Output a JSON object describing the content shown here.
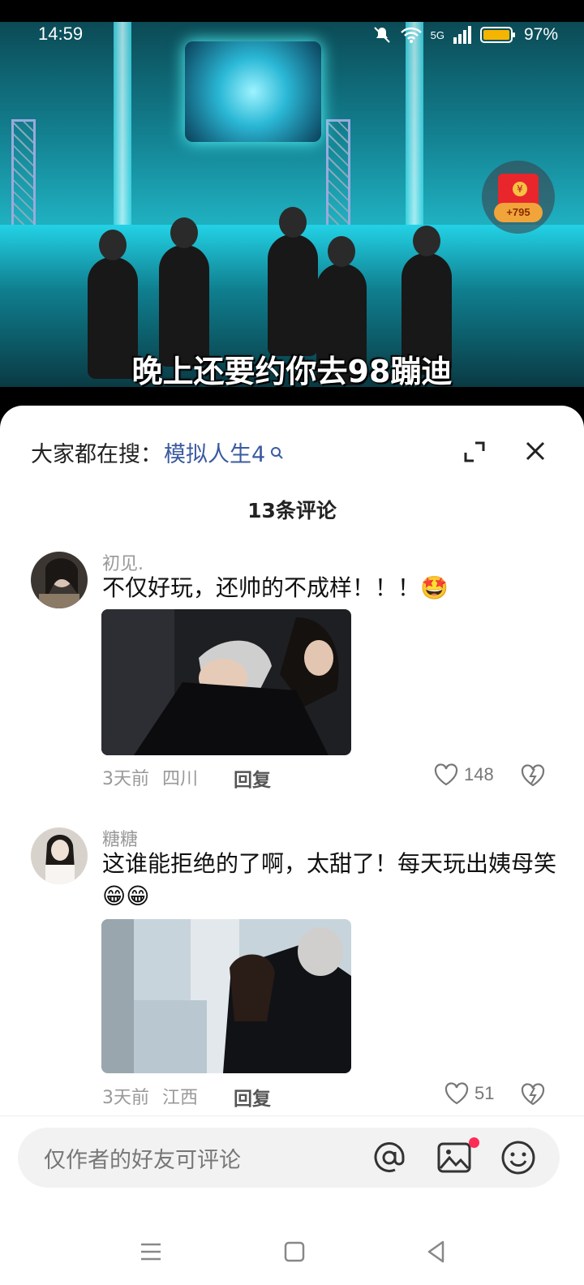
{
  "status_bar": {
    "time": "14:59",
    "network": "5G",
    "battery": "97%"
  },
  "video": {
    "subtitle": "晚上还要约你去98蹦迪"
  },
  "red_packet": {
    "badge": "+795"
  },
  "sheet": {
    "search_prefix": "大家都在搜：",
    "search_keyword": "模拟人生4",
    "comment_count": "13条评论"
  },
  "comments": [
    {
      "user": "初见.",
      "text": "不仅好玩，还帅的不成样！！！🤩",
      "time": "3天前",
      "location": "四川",
      "reply_label": "回复",
      "likes": "148"
    },
    {
      "user": "糖糖",
      "text": "这谁能拒绝的了啊，太甜了！每天玩出姨母笑😁😁",
      "time": "3天前",
      "location": "江西",
      "reply_label": "回复",
      "likes": "51"
    }
  ],
  "input": {
    "placeholder": "仅作者的好友可评论"
  },
  "colors": {
    "accent_red": "#fe2c55",
    "keyword_blue": "#3b5aa0",
    "sheet_bg": "#ffffff"
  }
}
